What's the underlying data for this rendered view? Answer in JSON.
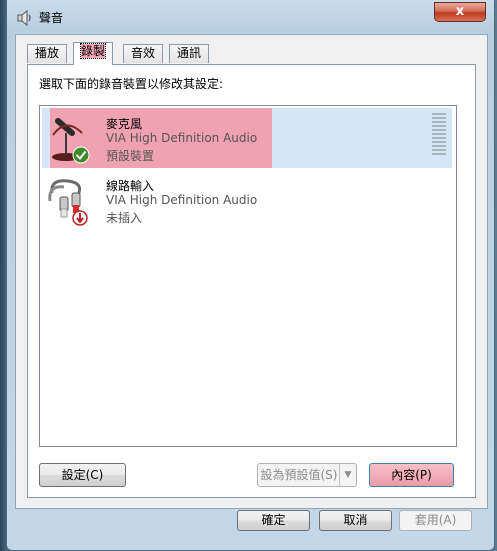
{
  "window": {
    "title": "聲音",
    "close_glyph": "x"
  },
  "tabs": [
    {
      "label": "播放"
    },
    {
      "label": "錄製"
    },
    {
      "label": "音效"
    },
    {
      "label": "通訊"
    }
  ],
  "instruction": "選取下面的錄音裝置以修改其設定:",
  "devices": [
    {
      "name": "麥克風",
      "driver": "VIA High Definition Audio",
      "status": "預設裝置",
      "icon": "microphone-icon",
      "badge": "default-check-icon"
    },
    {
      "name": "線路輸入",
      "driver": "VIA High Definition Audio",
      "status": "未插入",
      "icon": "line-in-cable-icon",
      "badge": "unplugged-icon"
    }
  ],
  "buttons": {
    "configure": "設定(C)",
    "set_default": "設為預設值(S)",
    "properties": "內容(P)",
    "ok": "確定",
    "cancel": "取消",
    "apply": "套用(A)"
  },
  "colors": {
    "selection_highlight": "#f1a2b2",
    "close_button": "#c0391f"
  }
}
